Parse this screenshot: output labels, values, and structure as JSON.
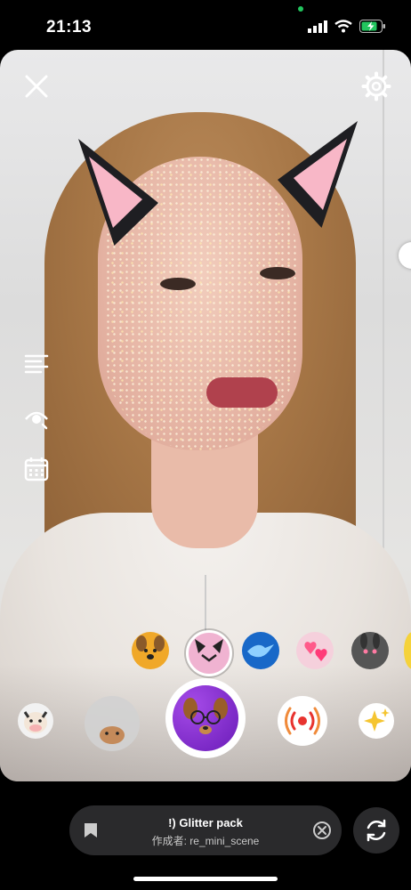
{
  "status_bar": {
    "time": "21:13"
  },
  "camera": {
    "left_tools": [
      "menu-lines",
      "eye-flash",
      "calendar"
    ],
    "zoom_handle": true
  },
  "effects_row": [
    {
      "name": "dog-face-effect"
    },
    {
      "name": "cat-face-effect",
      "selected": true
    },
    {
      "name": "blue-bird-effect"
    },
    {
      "name": "hearts-effect"
    },
    {
      "name": "black-bunny-effect"
    },
    {
      "name": "yellow-effect-partial"
    }
  ],
  "capture_row": [
    {
      "name": "cow-effect"
    },
    {
      "name": "hamster-effect"
    },
    {
      "name": "live-effect"
    },
    {
      "name": "sparkle-effect"
    }
  ],
  "effect_pill": {
    "title": "!) Glitter pack",
    "creator": "作成者: re_mini_scene"
  },
  "colors": {
    "accent_purple": "#7b2fd0",
    "pill_bg": "#2a2a2c",
    "battery_green": "#22c55e"
  }
}
